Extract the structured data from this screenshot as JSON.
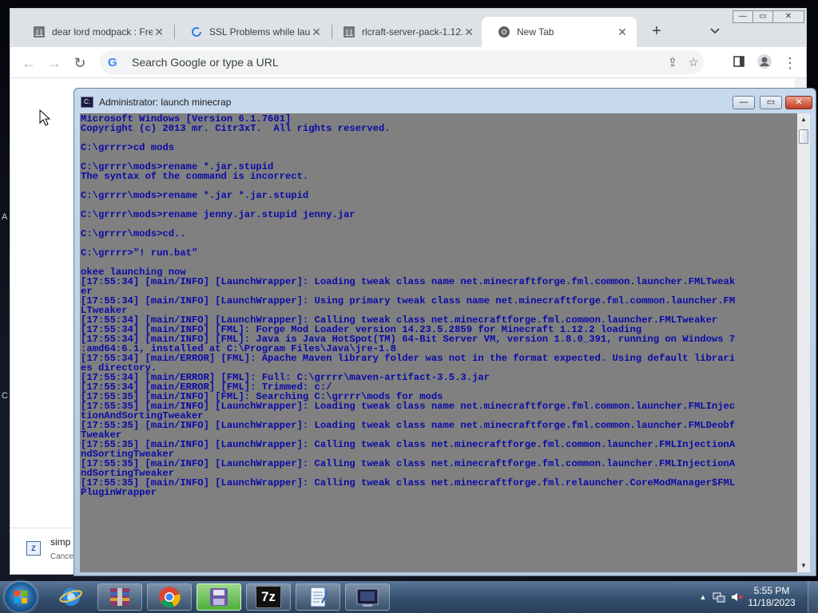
{
  "browser": {
    "tabs": [
      {
        "title": "dear lord modpack : Fre",
        "icon": "library-icon"
      },
      {
        "title": "SSL Problems while laun",
        "icon": "loading-icon"
      },
      {
        "title": "rlcraft-server-pack-1.12.",
        "icon": "library-icon"
      },
      {
        "title": "New Tab",
        "icon": "chrome-icon"
      }
    ],
    "omnibox_placeholder": "Search Google or type a URL",
    "download": {
      "name": "simp",
      "status": "Cance"
    }
  },
  "cmd": {
    "title": "Administrator:  launch minecrap",
    "lines": [
      "Microsoft Windows [Version 6.1.7601]",
      "Copyright (c) 2013 mr. Citr3xT.  All rights reserved.",
      "",
      "C:\\grrrr>cd mods",
      "",
      "C:\\grrrr\\mods>rename *.jar.stupid",
      "The syntax of the command is incorrect.",
      "",
      "C:\\grrrr\\mods>rename *.jar *.jar.stupid",
      "",
      "C:\\grrrr\\mods>rename jenny.jar.stupid jenny.jar",
      "",
      "C:\\grrrr\\mods>cd..",
      "",
      "C:\\grrrr>\"! run.bat\"",
      "",
      "okee launching now",
      "[17:55:34] [main/INFO] [LaunchWrapper]: Loading tweak class name net.minecraftforge.fml.common.launcher.FMLTweak",
      "er",
      "[17:55:34] [main/INFO] [LaunchWrapper]: Using primary tweak class name net.minecraftforge.fml.common.launcher.FM",
      "LTweaker",
      "[17:55:34] [main/INFO] [LaunchWrapper]: Calling tweak class net.minecraftforge.fml.common.launcher.FMLTweaker",
      "[17:55:34] [main/INFO] [FML]: Forge Mod Loader version 14.23.5.2859 for Minecraft 1.12.2 loading",
      "[17:55:34] [main/INFO] [FML]: Java is Java HotSpot(TM) 64-Bit Server VM, version 1.8.0_391, running on Windows 7",
      ":amd64:6.1, installed at C:\\Program Files\\Java\\jre-1.8",
      "[17:55:34] [main/ERROR] [FML]: Apache Maven library folder was not in the format expected. Using default librari",
      "es directory.",
      "[17:55:34] [main/ERROR] [FML]: Full: C:\\grrrr\\maven-artifact-3.5.3.jar",
      "[17:55:34] [main/ERROR] [FML]: Trimmed: c:/",
      "[17:55:35] [main/INFO] [FML]: Searching C:\\grrrr\\mods for mods",
      "[17:55:35] [main/INFO] [LaunchWrapper]: Loading tweak class name net.minecraftforge.fml.common.launcher.FMLInjec",
      "tionAndSortingTweaker",
      "[17:55:35] [main/INFO] [LaunchWrapper]: Loading tweak class name net.minecraftforge.fml.common.launcher.FMLDeobf",
      "Tweaker",
      "[17:55:35] [main/INFO] [LaunchWrapper]: Calling tweak class net.minecraftforge.fml.common.launcher.FMLInjectionA",
      "ndSortingTweaker",
      "[17:55:35] [main/INFO] [LaunchWrapper]: Calling tweak class net.minecraftforge.fml.common.launcher.FMLInjectionA",
      "ndSortingTweaker",
      "[17:55:35] [main/INFO] [LaunchWrapper]: Calling tweak class net.minecraftforge.fml.relauncher.CoreModManager$FML",
      "PluginWrapper"
    ],
    "text_color": "#0a0aa8",
    "background_color": "#808080"
  },
  "taskbar": {
    "items": [
      {
        "name": "internet-explorer",
        "icon": "ie-icon"
      },
      {
        "name": "winrar",
        "icon": "winrar-icon"
      },
      {
        "name": "chrome",
        "icon": "chrome-icon"
      },
      {
        "name": "floppy-app",
        "icon": "floppy-icon"
      },
      {
        "name": "7zip",
        "icon": "7zip-icon",
        "label": "7z"
      },
      {
        "name": "notepad",
        "icon": "notepad-icon"
      },
      {
        "name": "cmd",
        "icon": "cmd-icon"
      }
    ],
    "clock": {
      "time": "5:55 PM",
      "date": "11/18/2023"
    }
  }
}
